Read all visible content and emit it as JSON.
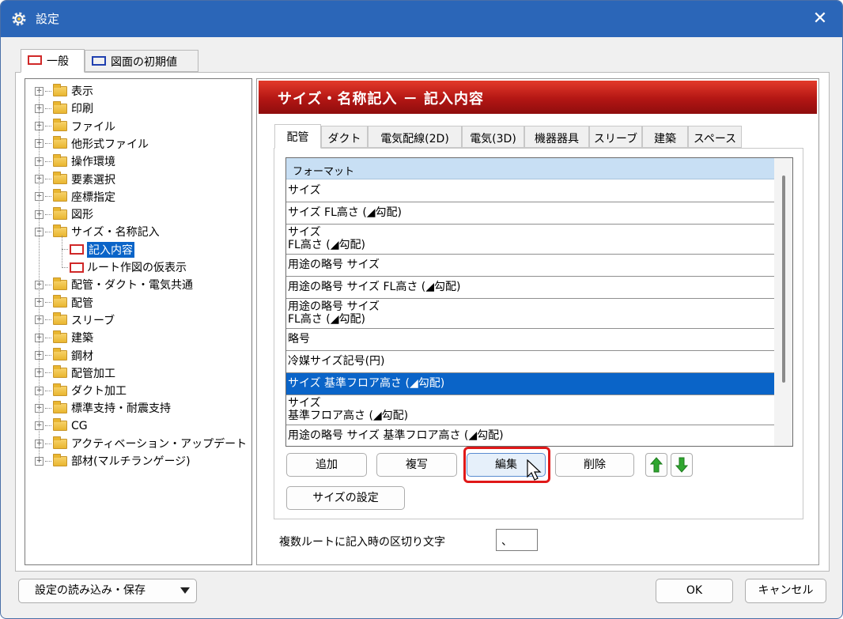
{
  "window": {
    "title": "設定",
    "close_glyph": "✕"
  },
  "top_tabs": [
    {
      "label": "一般",
      "active": true
    },
    {
      "label": "図面の初期値",
      "active": false
    }
  ],
  "tree": {
    "items": [
      {
        "label": "表示",
        "expanded": false
      },
      {
        "label": "印刷",
        "expanded": false
      },
      {
        "label": "ファイル",
        "expanded": false
      },
      {
        "label": "他形式ファイル",
        "expanded": false
      },
      {
        "label": "操作環境",
        "expanded": false
      },
      {
        "label": "要素選択",
        "expanded": false
      },
      {
        "label": "座標指定",
        "expanded": false
      },
      {
        "label": "図形",
        "expanded": false
      },
      {
        "label": "サイズ・名称記入",
        "expanded": true
      },
      {
        "label": "記入内容",
        "child": true,
        "selected": true
      },
      {
        "label": "ルート作図の仮表示",
        "child": true
      },
      {
        "label": "配管・ダクト・電気共通",
        "expanded": false
      },
      {
        "label": "配管",
        "expanded": false
      },
      {
        "label": "スリーブ",
        "expanded": false
      },
      {
        "label": "建築",
        "expanded": false
      },
      {
        "label": "鋼材",
        "expanded": false
      },
      {
        "label": "配管加工",
        "expanded": false
      },
      {
        "label": "ダクト加工",
        "expanded": false
      },
      {
        "label": "標準支持・耐震支持",
        "expanded": false
      },
      {
        "label": "CG",
        "expanded": false
      },
      {
        "label": "アクティベーション・アップデート",
        "expanded": false
      },
      {
        "label": "部材(マルチランゲージ)",
        "expanded": false
      }
    ]
  },
  "section": {
    "title": "サイズ・名称記入 － 記入内容"
  },
  "sub_tabs": [
    {
      "label": "配管",
      "active": true
    },
    {
      "label": "ダクト"
    },
    {
      "label": "電気配線(2D)"
    },
    {
      "label": "電気(3D)"
    },
    {
      "label": "機器器具"
    },
    {
      "label": "スリーブ"
    },
    {
      "label": "建築"
    },
    {
      "label": "スペース"
    }
  ],
  "format_list": {
    "header": "フォーマット",
    "rows": [
      {
        "text": "サイズ"
      },
      {
        "text": "サイズ FL高さ (◢勾配)"
      },
      {
        "text": "サイズ\nFL高さ (◢勾配)"
      },
      {
        "text": "用途の略号 サイズ"
      },
      {
        "text": "用途の略号 サイズ FL高さ (◢勾配)"
      },
      {
        "text": "用途の略号 サイズ\nFL高さ (◢勾配)"
      },
      {
        "text": "略号"
      },
      {
        "text": "冷媒サイズ記号(円)"
      },
      {
        "text": "サイズ 基準フロア高さ (◢勾配)",
        "selected": true
      },
      {
        "text": "サイズ\n基準フロア高さ (◢勾配)"
      },
      {
        "text": "用途の略号 サイズ 基準フロア高さ (◢勾配)"
      }
    ]
  },
  "buttons": {
    "add": "追加",
    "copy": "複写",
    "edit": "編集",
    "delete": "削除",
    "size_settings": "サイズの設定",
    "ok": "OK",
    "cancel": "キャンセル",
    "load_save": "設定の読み込み・保存"
  },
  "separator": {
    "label": "複数ルートに記入時の区切り文字",
    "value": "、"
  },
  "colors": {
    "titlebar": "#2b66b8",
    "selection": "#0a64c8",
    "banner": "#b31614",
    "highlight": "#e01818",
    "arrow_green": "#2fa62f"
  }
}
